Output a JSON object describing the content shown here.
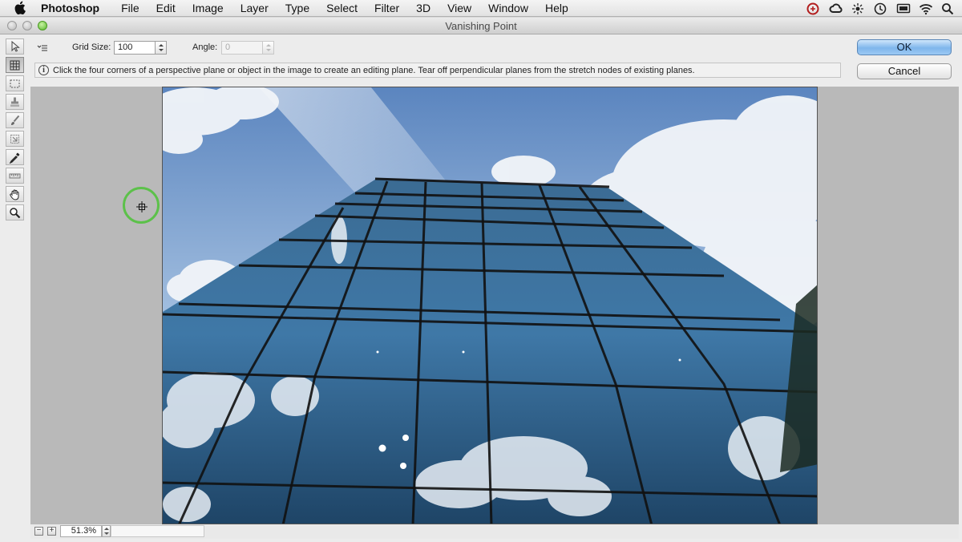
{
  "menubar": {
    "apple_icon": "apple-logo-icon",
    "app_name": "Photoshop",
    "items": [
      "File",
      "Edit",
      "Image",
      "Layer",
      "Type",
      "Select",
      "Filter",
      "3D",
      "View",
      "Window",
      "Help"
    ],
    "status_icons": [
      "adobe-updater-icon",
      "creative-cloud-icon",
      "brightness-icon",
      "time-machine-icon",
      "display-mirroring-icon",
      "wifi-icon",
      "search-icon"
    ]
  },
  "dialog": {
    "title": "Vanishing Point",
    "options": {
      "grid_size_label": "Grid Size:",
      "grid_size_value": "100",
      "angle_label": "Angle:",
      "angle_value": "0"
    },
    "info_text": "Click the four corners of a perspective plane or object in the image to create an editing plane. Tear off perpendicular planes from the stretch nodes of existing planes.",
    "ok_label": "OK",
    "cancel_label": "Cancel",
    "zoom_value": "51.3%",
    "zoom_out_glyph": "−",
    "zoom_in_glyph": "+",
    "tools": [
      {
        "name": "edit-plane-tool",
        "active": false
      },
      {
        "name": "create-plane-tool",
        "active": true
      },
      {
        "name": "marquee-tool",
        "active": false
      },
      {
        "name": "stamp-tool",
        "active": false
      },
      {
        "name": "brush-tool",
        "active": false
      },
      {
        "name": "transform-tool",
        "active": false
      },
      {
        "name": "eyedropper-tool",
        "active": false
      },
      {
        "name": "measure-tool",
        "active": false
      },
      {
        "name": "hand-tool",
        "active": false
      },
      {
        "name": "zoom-tool",
        "active": false
      }
    ]
  },
  "colors": {
    "ok_button": "#7fb6ec",
    "cursor_highlight": "#5cc14a",
    "canvas_bg": "#b9b9b9"
  }
}
